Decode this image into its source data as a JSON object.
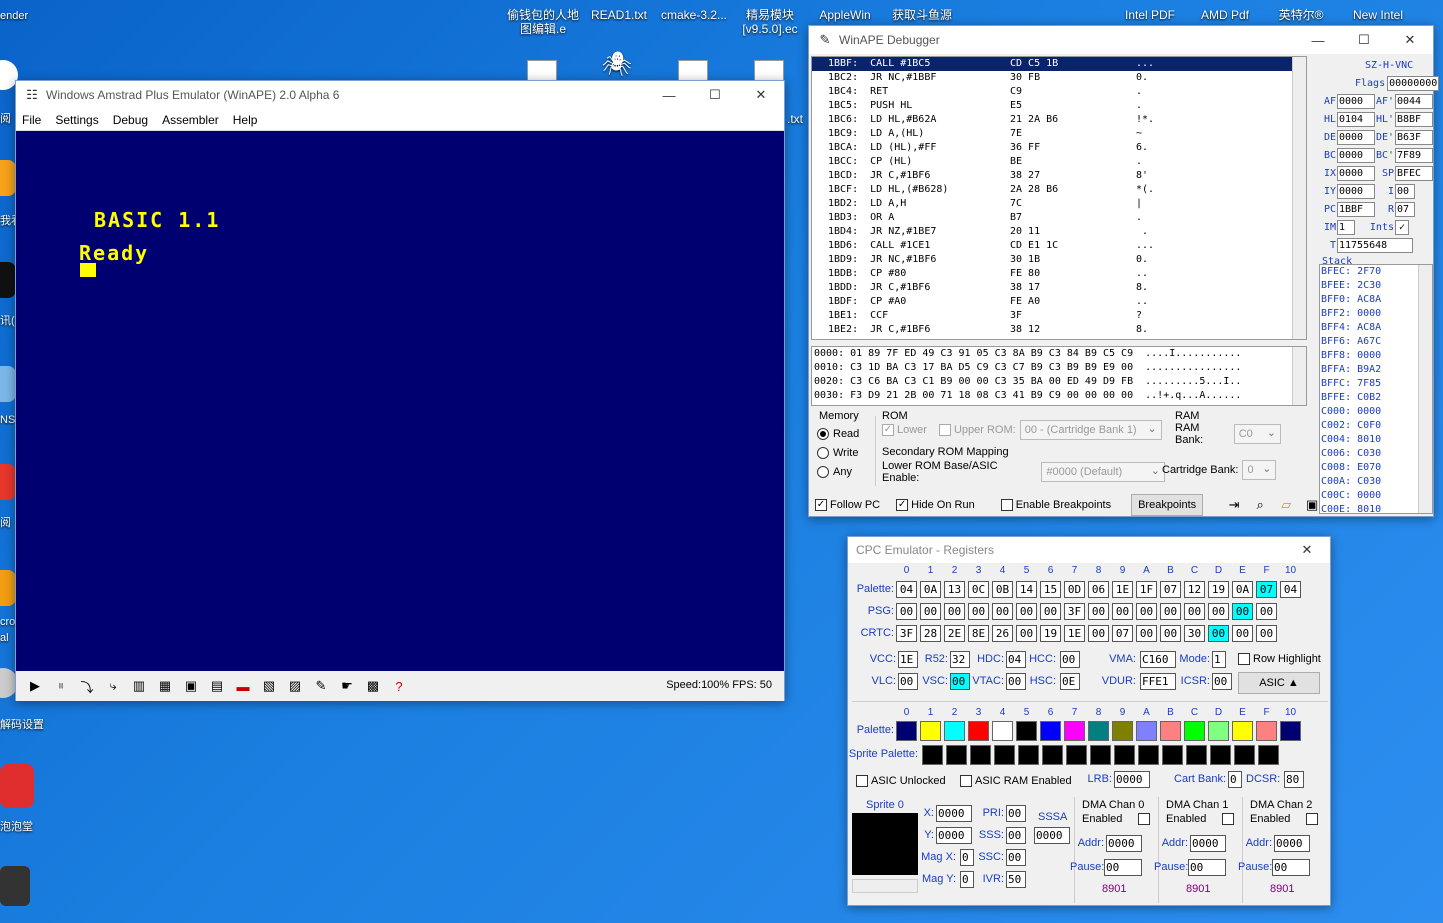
{
  "desktop": {
    "top_icons": [
      {
        "label": "偷钱包的人地\n图编辑.e"
      },
      {
        "label": "READ1.txt"
      },
      {
        "label": "cmake-3.2..."
      },
      {
        "label": "精易模块\n[v9.5.0].ec"
      },
      {
        "label": "AppleWin"
      },
      {
        "label": "获取斗鱼源"
      },
      {
        "label": "Intel PDF"
      },
      {
        "label": "AMD Pdf"
      },
      {
        "label": "英特尔®"
      },
      {
        "label": "New Intel"
      }
    ],
    "left_labels": [
      "ender",
      "阅",
      "我看",
      "讯(",
      "NS",
      "阅",
      "cro",
      "al",
      "解码设置",
      "泡泡堂",
      ".txt"
    ]
  },
  "emulator": {
    "title": "Windows Amstrad Plus Emulator (WinAPE) 2.0 Alpha 6",
    "menu": [
      "File",
      "Settings",
      "Debug",
      "Assembler",
      "Help"
    ],
    "screen_line1": "BASIC 1.1",
    "screen_line2": "Ready",
    "status": "Speed:100%  FPS: 50"
  },
  "debugger": {
    "title": "WinAPE Debugger",
    "disasm": [
      [
        "1BBF:  CALL #1BC5",
        "CD C5 1B",
        "..."
      ],
      [
        "1BC2:  JR NC,#1BBF",
        "30 FB",
        "0."
      ],
      [
        "1BC4:  RET",
        "C9",
        "."
      ],
      [
        "1BC5:  PUSH HL",
        "E5",
        "."
      ],
      [
        "1BC6:  LD HL,#B62A",
        "21 2A B6",
        "!*."
      ],
      [
        "1BC9:  LD A,(HL)",
        "7E",
        "~"
      ],
      [
        "1BCA:  LD (HL),#FF",
        "36 FF",
        "6."
      ],
      [
        "1BCC:  CP (HL)",
        "BE",
        "."
      ],
      [
        "1BCD:  JR C,#1BF6",
        "38 27",
        "8'"
      ],
      [
        "1BCF:  LD HL,(#B628)",
        "2A 28 B6",
        "*(."
      ],
      [
        "1BD2:  LD A,H",
        "7C",
        "|"
      ],
      [
        "1BD3:  OR A",
        "B7",
        "."
      ],
      [
        "1BD4:  JR NZ,#1BE7",
        "20 11",
        " ."
      ],
      [
        "1BD6:  CALL #1CE1",
        "CD E1 1C",
        "..."
      ],
      [
        "1BD9:  JR NC,#1BF6",
        "30 1B",
        "0."
      ],
      [
        "1BDB:  CP #80",
        "FE 80",
        ".."
      ],
      [
        "1BDD:  JR C,#1BF6",
        "38 17",
        "8."
      ],
      [
        "1BDF:  CP #A0",
        "FE A0",
        ".."
      ],
      [
        "1BE1:  CCF",
        "3F",
        "?"
      ],
      [
        "1BE2:  JR C,#1BF6",
        "38 12",
        "8."
      ]
    ],
    "registers": [
      {
        "l1": "",
        "v1": "",
        "l2": "SZ-H-VNC",
        "v2": ""
      },
      {
        "l1": "",
        "v1": "",
        "l2": "Flags",
        "v2": "00000000"
      },
      {
        "l1": "AF",
        "v1": "0000",
        "l2": "AF'",
        "v2": "0044"
      },
      {
        "l1": "HL",
        "v1": "0104",
        "l2": "HL'",
        "v2": "B8BF"
      },
      {
        "l1": "DE",
        "v1": "0000",
        "l2": "DE'",
        "v2": "B63F"
      },
      {
        "l1": "BC",
        "v1": "0000",
        "l2": "BC'",
        "v2": "7F89"
      },
      {
        "l1": "IX",
        "v1": "0000",
        "l2": "SP",
        "v2": "BFEC"
      },
      {
        "l1": "IY",
        "v1": "0000",
        "l2": "I",
        "v2": "00"
      },
      {
        "l1": "PC",
        "v1": "1BBF",
        "l2": "R",
        "v2": "07"
      },
      {
        "l1": "IM",
        "v1": "1",
        "l2": "Ints",
        "v2": "✓"
      },
      {
        "l1": "T",
        "v1": "11755648",
        "l2": "",
        "v2": ""
      }
    ],
    "stack_label": "Stack",
    "stack": [
      "BFEC: 2F70",
      "BFEE: 2C30",
      "BFF0: AC8A",
      "BFF2: 0000",
      "BFF4: AC8A",
      "BFF6: A67C",
      "BFF8: 0000",
      "BFFA: B9A2",
      "BFFC: 7F85",
      "BFFE: C0B2",
      "C000: 0000",
      "C002: C0F0",
      "C004: 8010",
      "C006: C030",
      "C008: E070",
      "C00A: C030",
      "C00C: 0000",
      "C00E: 8010"
    ],
    "memory": [
      "0000: 01 89 7F ED 49 C3 91 05 C3 8A B9 C3 84 B9 C5 C9  ....I...........",
      "0010: C3 1D BA C3 17 BA D5 C9 C3 C7 B9 C3 B9 B9 E9 00  ................",
      "0020: C3 C6 BA C3 C1 B9 00 00 C3 35 BA 00 ED 49 D9 FB  .........5...I..",
      "0030: F3 D9 21 2B 00 71 18 08 C3 41 B9 C9 00 00 00 00  ..!+.q...A......"
    ],
    "memory_group": "Memory",
    "mem_read": "Read",
    "mem_write": "Write",
    "mem_any": "Any",
    "rom_group": "ROM",
    "rom_lower": "Lower",
    "rom_upper": "Upper ROM:",
    "rom_upper_val": "00 - (Cartridge Bank 1)",
    "rom_secondary": "Secondary ROM Mapping",
    "rom_lower_base": "Lower ROM Base/ASIC Enable:",
    "rom_lower_base_val": "#0000 (Default)",
    "cart_bank": "Cartridge Bank:",
    "cart_bank_val": "0",
    "ram_group": "RAM",
    "ram_bank": "RAM Bank:",
    "ram_bank_val": "C0",
    "follow_pc": "Follow PC",
    "hide_on_run": "Hide On Run",
    "enable_bp": "Enable Breakpoints",
    "breakpoints": "Breakpoints"
  },
  "regwin": {
    "title": "CPC Emulator - Registers",
    "headers": [
      "0",
      "1",
      "2",
      "3",
      "4",
      "5",
      "6",
      "7",
      "8",
      "9",
      "A",
      "B",
      "C",
      "D",
      "E",
      "F",
      "10"
    ],
    "palette_label": "Palette:",
    "palette": [
      "04",
      "0A",
      "13",
      "0C",
      "0B",
      "14",
      "15",
      "0D",
      "06",
      "1E",
      "1F",
      "07",
      "12",
      "19",
      "0A",
      "07",
      "04"
    ],
    "psg_label": "PSG:",
    "psg": [
      "00",
      "00",
      "00",
      "00",
      "00",
      "00",
      "00",
      "3F",
      "00",
      "00",
      "00",
      "00",
      "00",
      "00",
      "00",
      "00"
    ],
    "crtc_label": "CRTC:",
    "crtc": [
      "3F",
      "28",
      "2E",
      "8E",
      "26",
      "00",
      "19",
      "1E",
      "00",
      "07",
      "00",
      "00",
      "30",
      "00",
      "00",
      "00"
    ],
    "vcc_label": "VCC:",
    "vcc": "1E",
    "r52_label": "R52:",
    "r52": "32",
    "hdc_label": "HDC:",
    "hdc": "04",
    "hcc_label": "HCC:",
    "hcc": "00",
    "vma_label": "VMA:",
    "vma": "C160",
    "mode_label": "Mode:",
    "mode": "1",
    "row_highlight": "Row Highlight",
    "vlc_label": "VLC:",
    "vlc": "00",
    "vsc_label": "VSC:",
    "vsc": "00",
    "vtac_label": "VTAC:",
    "vtac": "00",
    "hsc_label": "HSC:",
    "hsc": "0E",
    "vdur_label": "VDUR:",
    "vdur": "FFE1",
    "icsr_label": "ICSR:",
    "icsr": "00",
    "asic_btn": "ASIC   ▲",
    "asic_palette_label": "Palette:",
    "asic_colors": [
      "#000070",
      "#ffff00",
      "#00ffff",
      "#ff0000",
      "#ffffff",
      "#000000",
      "#0000ff",
      "#ff00ff",
      "#008080",
      "#808000",
      "#8080ff",
      "#ff8080",
      "#00ff00",
      "#80ff80",
      "#ffff00",
      "#ff8080",
      "#000070"
    ],
    "sprite_palette_label": "Sprite Palette:",
    "asic_unlocked": "ASIC Unlocked",
    "asic_ram": "ASIC RAM Enabled",
    "lrb_label": "LRB:",
    "lrb": "0000",
    "cartbank_label": "Cart Bank:",
    "cartbank": "0",
    "dcsr_label": "DCSR:",
    "dcsr": "80",
    "sprite_label": "Sprite 0",
    "x_label": "X:",
    "x": "0000",
    "y_label": "Y:",
    "y": "0000",
    "magx_label": "Mag X:",
    "magx": "0",
    "magy_label": "Mag Y:",
    "magy": "0",
    "pri_label": "PRI:",
    "pri": "00",
    "sss_label": "SSS:",
    "sss": "00",
    "ssc_label": "SSC:",
    "ssc": "00",
    "ivr_label": "IVR:",
    "ivr": "50",
    "sssa_label": "SSSA",
    "sssa": "0000",
    "dma": [
      {
        "title": "DMA Chan 0",
        "enabled": "Enabled",
        "addr_label": "Addr:",
        "addr": "0000",
        "pause_label": "Pause:",
        "pause": "00",
        "val": "8901"
      },
      {
        "title": "DMA Chan 1",
        "enabled": "Enabled",
        "addr_label": "Addr:",
        "addr": "0000",
        "pause_label": "Pause:",
        "pause": "00",
        "val": "8901"
      },
      {
        "title": "DMA Chan 2",
        "enabled": "Enabled",
        "addr_label": "Addr:",
        "addr": "0000",
        "pause_label": "Pause:",
        "pause": "00",
        "val": "8901"
      }
    ]
  }
}
